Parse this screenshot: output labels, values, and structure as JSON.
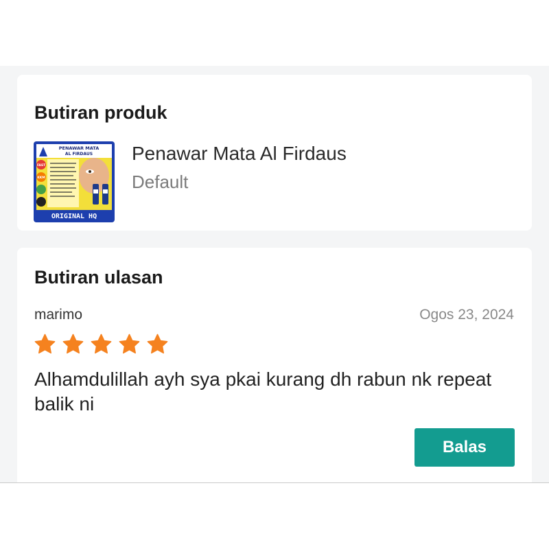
{
  "product_section": {
    "title": "Butiran produk",
    "product": {
      "name": "Penawar Mata Al Firdaus",
      "variant": "Default",
      "image": {
        "heading_line1": "PENAWAR MATA",
        "heading_line2": "AL FIRDAUS",
        "badge_fast": "FAST",
        "badge_kkm": "KKM",
        "footer": "ORIGINAL HQ"
      }
    }
  },
  "review_section": {
    "title": "Butiran ulasan",
    "reviewer": "marimo",
    "date": "Ogos 23, 2024",
    "rating": 5,
    "rating_max": 5,
    "text": "Alhamdulillah ayh sya pkai kurang dh rabun nk repeat balik ni",
    "reply_label": "Balas"
  },
  "colors": {
    "accent": "#139c90",
    "star": "#f5821f",
    "background": "#f4f5f6"
  }
}
